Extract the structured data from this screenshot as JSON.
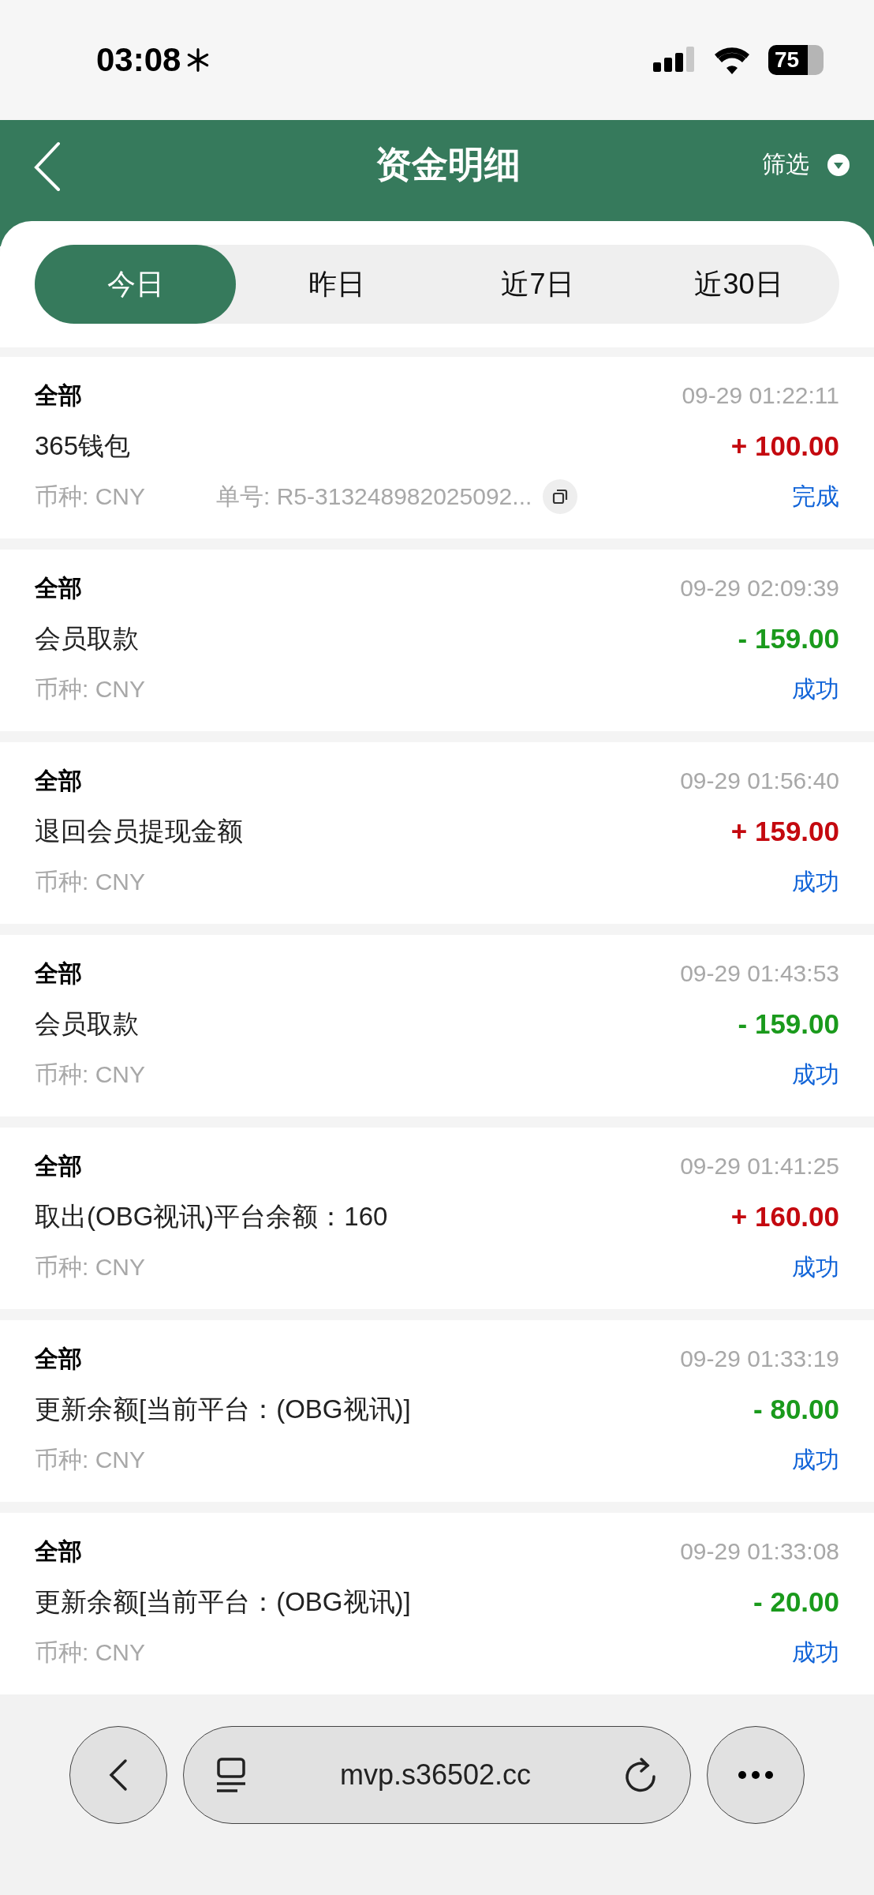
{
  "status_bar": {
    "time": "03:08",
    "battery": "75"
  },
  "header": {
    "title": "资金明细",
    "filter": "筛选"
  },
  "tabs": [
    {
      "label": "今日",
      "selected": true
    },
    {
      "label": "昨日",
      "selected": false
    },
    {
      "label": "近7日",
      "selected": false
    },
    {
      "label": "近30日",
      "selected": false
    }
  ],
  "records": [
    {
      "category": "全部",
      "time": "09-29 01:22:11",
      "name": "365钱包",
      "amount": "+ 100.00",
      "color": "#c4090f",
      "currency": "币种: CNY",
      "order_no": "单号: R5-313248982025092...",
      "status": "完成"
    },
    {
      "category": "全部",
      "time": "09-29 02:09:39",
      "name": "会员取款",
      "amount": "- 159.00",
      "color": "#1a9a1c",
      "currency": "币种: CNY",
      "status": "成功"
    },
    {
      "category": "全部",
      "time": "09-29 01:56:40",
      "name": "退回会员提现金额",
      "amount": "+ 159.00",
      "color": "#c4090f",
      "currency": "币种: CNY",
      "status": "成功"
    },
    {
      "category": "全部",
      "time": "09-29 01:43:53",
      "name": "会员取款",
      "amount": "- 159.00",
      "color": "#1a9a1c",
      "currency": "币种: CNY",
      "status": "成功"
    },
    {
      "category": "全部",
      "time": "09-29 01:41:25",
      "name": "取出(OBG视讯)平台余额：160",
      "amount": "+ 160.00",
      "color": "#c4090f",
      "currency": "币种: CNY",
      "status": "成功"
    },
    {
      "category": "全部",
      "time": "09-29 01:33:19",
      "name": "更新余额[当前平台：(OBG视讯)]",
      "amount": "- 80.00",
      "color": "#1a9a1c",
      "currency": "币种: CNY",
      "status": "成功"
    },
    {
      "category": "全部",
      "time": "09-29 01:33:08",
      "name": "更新余额[当前平台：(OBG视讯)]",
      "amount": "- 20.00",
      "color": "#1a9a1c",
      "currency": "币种: CNY",
      "status": "成功"
    }
  ],
  "browser_bar": {
    "url": "mvp.s36502.cc"
  }
}
